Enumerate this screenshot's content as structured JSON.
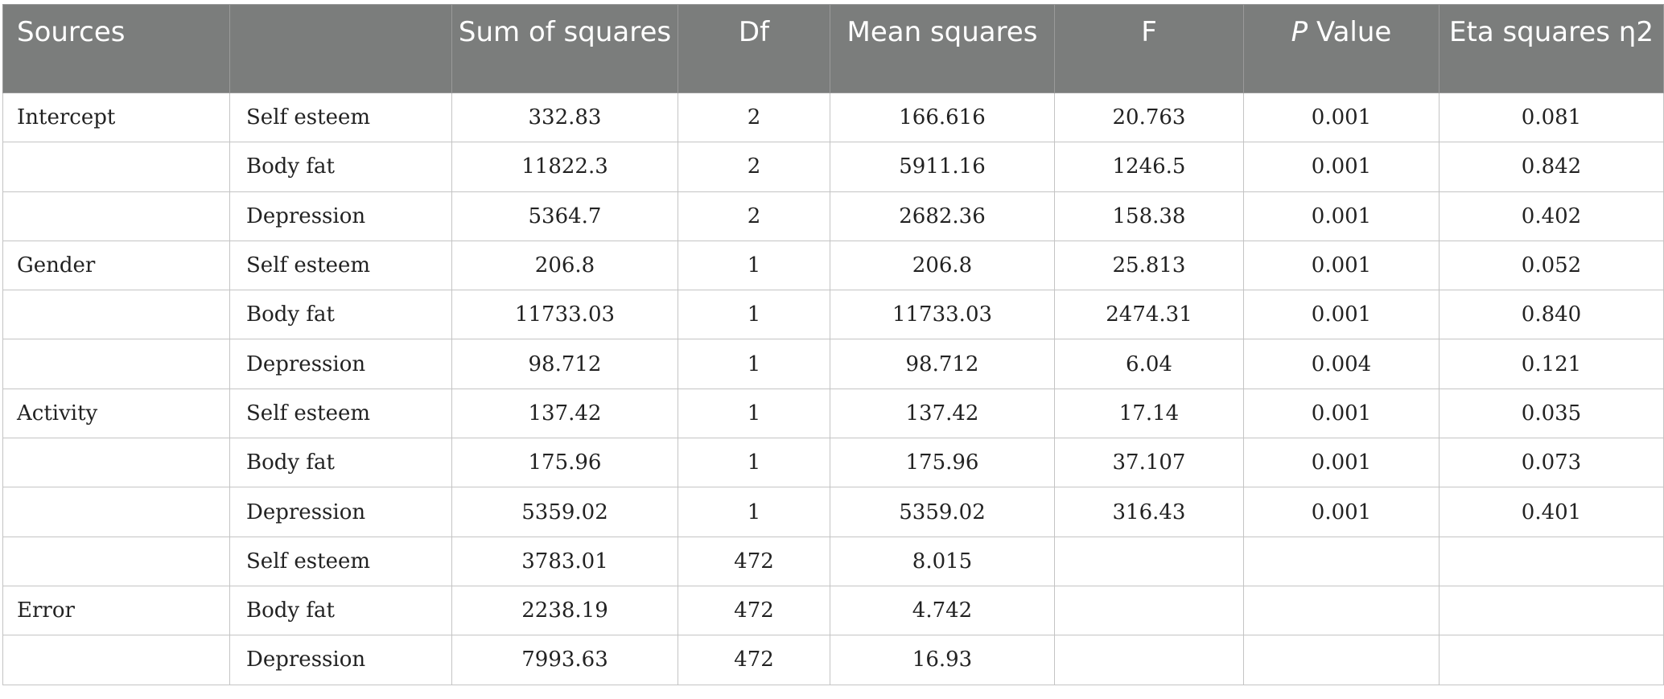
{
  "headers": {
    "sources": "Sources",
    "blank": "",
    "sum_of_squares": "Sum of squares",
    "df": "Df",
    "mean_squares": "Mean squares",
    "f": "F",
    "p_value_italic": "P",
    "p_value_rest": " Value",
    "eta_squares": "Eta squares η2"
  },
  "rows": [
    {
      "source": "Intercept",
      "measure": "Self esteem",
      "ss": "332.83",
      "df": "2",
      "ms": "166.616",
      "f": "20.763",
      "p": "0.001",
      "eta": "0.081"
    },
    {
      "source": "",
      "measure": "Body fat",
      "ss": "11822.3",
      "df": "2",
      "ms": "5911.16",
      "f": "1246.5",
      "p": "0.001",
      "eta": "0.842"
    },
    {
      "source": "",
      "measure": "Depression",
      "ss": "5364.7",
      "df": "2",
      "ms": "2682.36",
      "f": "158.38",
      "p": "0.001",
      "eta": "0.402"
    },
    {
      "source": "Gender",
      "measure": "Self esteem",
      "ss": "206.8",
      "df": "1",
      "ms": "206.8",
      "f": "25.813",
      "p": "0.001",
      "eta": "0.052"
    },
    {
      "source": "",
      "measure": "Body fat",
      "ss": "11733.03",
      "df": "1",
      "ms": "11733.03",
      "f": "2474.31",
      "p": "0.001",
      "eta": "0.840"
    },
    {
      "source": "",
      "measure": "Depression",
      "ss": "98.712",
      "df": "1",
      "ms": "98.712",
      "f": "6.04",
      "p": "0.004",
      "eta": "0.121"
    },
    {
      "source": "Activity",
      "measure": "Self esteem",
      "ss": "137.42",
      "df": "1",
      "ms": "137.42",
      "f": "17.14",
      "p": "0.001",
      "eta": "0.035"
    },
    {
      "source": "",
      "measure": "Body fat",
      "ss": "175.96",
      "df": "1",
      "ms": "175.96",
      "f": "37.107",
      "p": "0.001",
      "eta": "0.073"
    },
    {
      "source": "",
      "measure": "Depression",
      "ss": "5359.02",
      "df": "1",
      "ms": "5359.02",
      "f": "316.43",
      "p": "0.001",
      "eta": "0.401"
    },
    {
      "source": "",
      "measure": "Self esteem",
      "ss": "3783.01",
      "df": "472",
      "ms": "8.015",
      "f": "",
      "p": "",
      "eta": ""
    },
    {
      "source": "Error",
      "measure": "Body fat",
      "ss": "2238.19",
      "df": "472",
      "ms": "4.742",
      "f": "",
      "p": "",
      "eta": ""
    },
    {
      "source": "",
      "measure": "Depression",
      "ss": "7993.63",
      "df": "472",
      "ms": "16.93",
      "f": "",
      "p": "",
      "eta": ""
    }
  ]
}
